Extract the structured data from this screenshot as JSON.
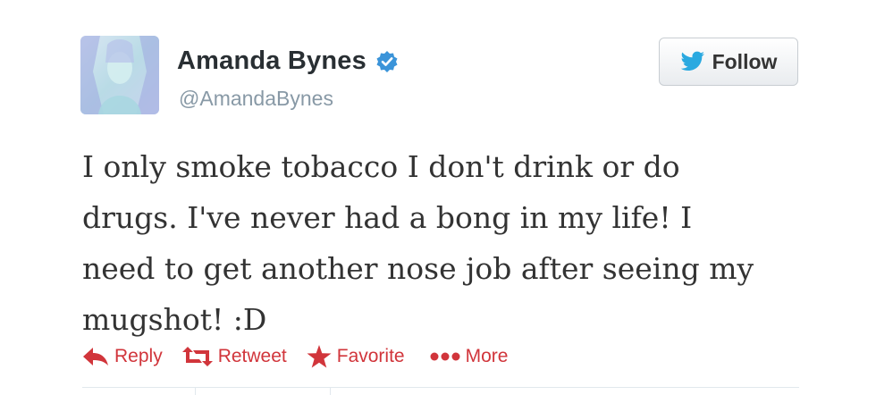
{
  "user": {
    "name": "Amanda Bynes",
    "handle": "@AmandaBynes",
    "verified": true
  },
  "follow_button": {
    "label": "Follow",
    "icon": "twitter-bird-icon"
  },
  "tweet": {
    "lines": [
      "I only smoke tobacco I don't drink or do",
      "drugs. I've never had a bong in my life! I",
      "need to get another nose job after seeing my",
      "mugshot! :D"
    ]
  },
  "actions": [
    {
      "label": "Reply",
      "icon": "reply-arrow-icon"
    },
    {
      "label": "Retweet",
      "icon": "retweet-icon"
    },
    {
      "label": "Favorite",
      "icon": "star-icon"
    },
    {
      "label": "More",
      "icon": "more-dots-icon"
    }
  ],
  "colors": {
    "action_red": "#d1353b",
    "handle_gray": "#8899a6",
    "verified_blue": "#3b94d9",
    "twitter_blue": "#2aa9e0"
  }
}
